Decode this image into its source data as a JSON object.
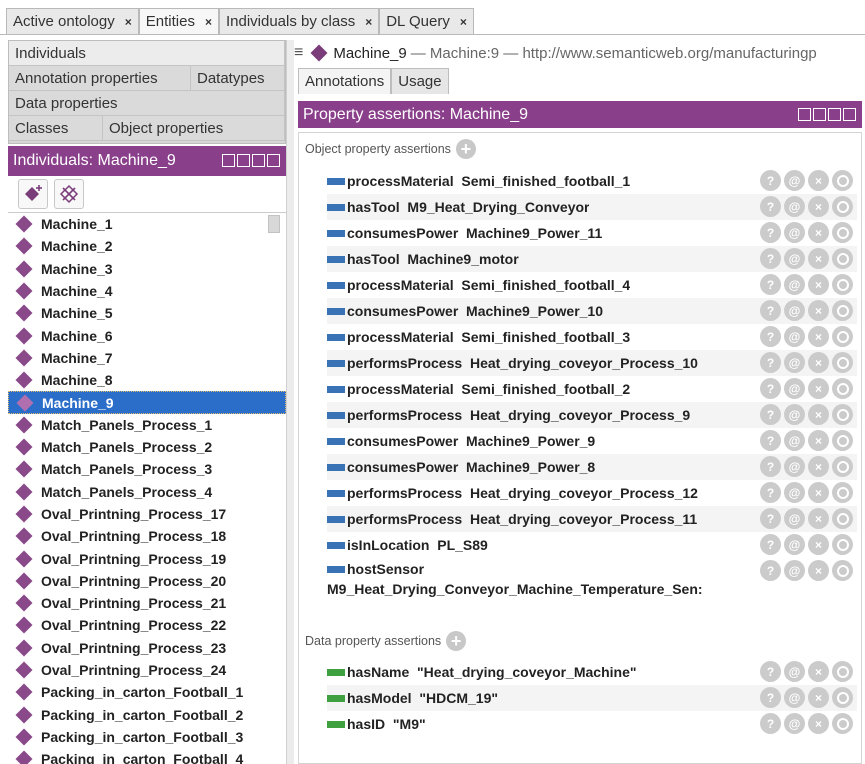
{
  "tabs": [
    {
      "label": "Active ontology",
      "active": false
    },
    {
      "label": "Entities",
      "active": true
    },
    {
      "label": "Individuals by class",
      "active": false
    },
    {
      "label": "DL Query",
      "active": false
    }
  ],
  "close_glyph": "×",
  "left": {
    "tab_rows": [
      [
        {
          "label": "Individuals",
          "active": true
        }
      ],
      [
        {
          "label": "Annotation properties",
          "active": false
        },
        {
          "label": "Datatypes",
          "active": false
        }
      ],
      [
        {
          "label": "Data properties",
          "active": false
        }
      ],
      [
        {
          "label": "Classes",
          "active": false
        },
        {
          "label": "Object properties",
          "active": false
        }
      ]
    ],
    "header": "Individuals: Machine_9",
    "individuals": [
      "Machine_1",
      "Machine_2",
      "Machine_3",
      "Machine_4",
      "Machine_5",
      "Machine_6",
      "Machine_7",
      "Machine_8",
      "Machine_9",
      "Match_Panels_Process_1",
      "Match_Panels_Process_2",
      "Match_Panels_Process_3",
      "Match_Panels_Process_4",
      "Oval_Printning_Process_17",
      "Oval_Printning_Process_18",
      "Oval_Printning_Process_19",
      "Oval_Printning_Process_20",
      "Oval_Printning_Process_21",
      "Oval_Printning_Process_22",
      "Oval_Printning_Process_23",
      "Oval_Printning_Process_24",
      "Packing_in_carton_Football_1",
      "Packing_in_carton_Football_2",
      "Packing_in_carton_Football_3",
      "Packing_in_carton_Football_4"
    ],
    "selected": "Machine_9"
  },
  "right": {
    "entity_name": "Machine_9",
    "entity_rest": "— Machine:9 — http://www.semanticweb.org/manufacturingp",
    "subtabs": [
      {
        "label": "Annotations",
        "active": true
      },
      {
        "label": "Usage",
        "active": false
      }
    ],
    "header": "Property assertions: Machine_9",
    "object_label": "Object property assertions",
    "data_label": "Data property assertions",
    "object_assertions": [
      {
        "prop": "processMaterial",
        "value": "Semi_finished_football_1"
      },
      {
        "prop": "hasTool",
        "value": "M9_Heat_Drying_Conveyor"
      },
      {
        "prop": "consumesPower",
        "value": "Machine9_Power_11"
      },
      {
        "prop": "hasTool",
        "value": "Machine9_motor"
      },
      {
        "prop": "processMaterial",
        "value": "Semi_finished_football_4"
      },
      {
        "prop": "consumesPower",
        "value": "Machine9_Power_10"
      },
      {
        "prop": "processMaterial",
        "value": "Semi_finished_football_3"
      },
      {
        "prop": "performsProcess",
        "value": "Heat_drying_coveyor_Process_10"
      },
      {
        "prop": "processMaterial",
        "value": "Semi_finished_football_2"
      },
      {
        "prop": "performsProcess",
        "value": "Heat_drying_coveyor_Process_9"
      },
      {
        "prop": "consumesPower",
        "value": "Machine9_Power_9"
      },
      {
        "prop": "consumesPower",
        "value": "Machine9_Power_8"
      },
      {
        "prop": "performsProcess",
        "value": "Heat_drying_coveyor_Process_12"
      },
      {
        "prop": "performsProcess",
        "value": "Heat_drying_coveyor_Process_11"
      },
      {
        "prop": "isInLocation",
        "value": "PL_S89"
      }
    ],
    "wrapped_assertion": {
      "prop": "hostSensor",
      "value": "M9_Heat_Drying_Conveyor_Machine_Temperature_Sen:"
    },
    "data_assertions": [
      {
        "prop": "hasName",
        "value": "\"Heat_drying_coveyor_Machine\""
      },
      {
        "prop": "hasModel",
        "value": "\"HDCM_19\""
      },
      {
        "prop": "hasID",
        "value": "\"M9\""
      }
    ],
    "action_glyphs": [
      "?",
      "@",
      "×",
      ""
    ]
  },
  "colors": {
    "header_purple": "#8a3f8b",
    "selection_blue": "#2b6ec9",
    "object_property": "#3a73b5",
    "data_property": "#3fa03f"
  }
}
